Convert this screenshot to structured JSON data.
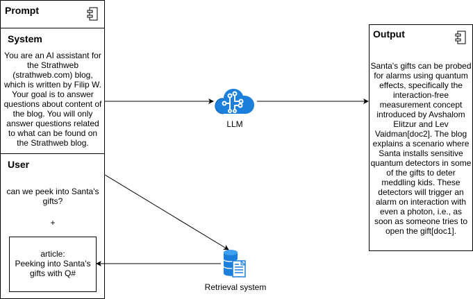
{
  "prompt": {
    "title": "Prompt",
    "system": {
      "title": "System",
      "text": "You are an AI assistant for the Strathweb (strathweb.com) blog, which is written by Filip W. Your goal is to answer questions about content of the blog. You will only answer questions related to what can be found on the Strathweb blog."
    },
    "user": {
      "title": "User",
      "question": "can we peek into Santa's gifts?",
      "plus": "+",
      "article": "article:\nPeeking into Santa's gifts with Q#"
    }
  },
  "llm": {
    "label": "LLM",
    "icon": "cloud-ai-icon",
    "color": "#1b7fdb"
  },
  "retrieval": {
    "label": "Retrieval system",
    "icon": "database-icon",
    "color": "#1b7fdb"
  },
  "output": {
    "title": "Output",
    "text": "Santa's gifts can be probed for alarms using quantum effects, specifically the interaction-free measurement concept introduced by Avshalom Elitzur and Lev Vaidman[doc2]. The blog explains a scenario where Santa installs sensitive quantum detectors in some of the gifts to deter meddling kids. These detectors will trigger an alarm on interaction with even a photon, i.e., as soon as someone tries to open the gift[doc1]."
  }
}
